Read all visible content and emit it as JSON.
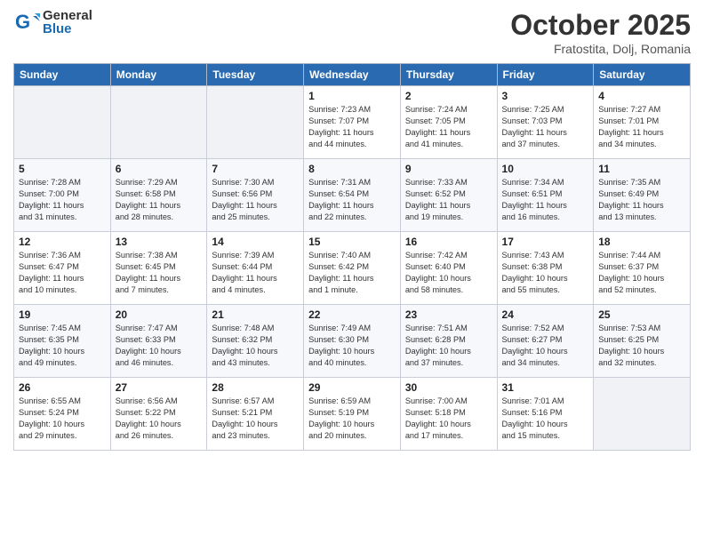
{
  "header": {
    "logo_general": "General",
    "logo_blue": "Blue",
    "month_title": "October 2025",
    "location": "Fratostita, Dolj, Romania"
  },
  "weekdays": [
    "Sunday",
    "Monday",
    "Tuesday",
    "Wednesday",
    "Thursday",
    "Friday",
    "Saturday"
  ],
  "weeks": [
    [
      {
        "day": "",
        "info": ""
      },
      {
        "day": "",
        "info": ""
      },
      {
        "day": "",
        "info": ""
      },
      {
        "day": "1",
        "info": "Sunrise: 7:23 AM\nSunset: 7:07 PM\nDaylight: 11 hours\nand 44 minutes."
      },
      {
        "day": "2",
        "info": "Sunrise: 7:24 AM\nSunset: 7:05 PM\nDaylight: 11 hours\nand 41 minutes."
      },
      {
        "day": "3",
        "info": "Sunrise: 7:25 AM\nSunset: 7:03 PM\nDaylight: 11 hours\nand 37 minutes."
      },
      {
        "day": "4",
        "info": "Sunrise: 7:27 AM\nSunset: 7:01 PM\nDaylight: 11 hours\nand 34 minutes."
      }
    ],
    [
      {
        "day": "5",
        "info": "Sunrise: 7:28 AM\nSunset: 7:00 PM\nDaylight: 11 hours\nand 31 minutes."
      },
      {
        "day": "6",
        "info": "Sunrise: 7:29 AM\nSunset: 6:58 PM\nDaylight: 11 hours\nand 28 minutes."
      },
      {
        "day": "7",
        "info": "Sunrise: 7:30 AM\nSunset: 6:56 PM\nDaylight: 11 hours\nand 25 minutes."
      },
      {
        "day": "8",
        "info": "Sunrise: 7:31 AM\nSunset: 6:54 PM\nDaylight: 11 hours\nand 22 minutes."
      },
      {
        "day": "9",
        "info": "Sunrise: 7:33 AM\nSunset: 6:52 PM\nDaylight: 11 hours\nand 19 minutes."
      },
      {
        "day": "10",
        "info": "Sunrise: 7:34 AM\nSunset: 6:51 PM\nDaylight: 11 hours\nand 16 minutes."
      },
      {
        "day": "11",
        "info": "Sunrise: 7:35 AM\nSunset: 6:49 PM\nDaylight: 11 hours\nand 13 minutes."
      }
    ],
    [
      {
        "day": "12",
        "info": "Sunrise: 7:36 AM\nSunset: 6:47 PM\nDaylight: 11 hours\nand 10 minutes."
      },
      {
        "day": "13",
        "info": "Sunrise: 7:38 AM\nSunset: 6:45 PM\nDaylight: 11 hours\nand 7 minutes."
      },
      {
        "day": "14",
        "info": "Sunrise: 7:39 AM\nSunset: 6:44 PM\nDaylight: 11 hours\nand 4 minutes."
      },
      {
        "day": "15",
        "info": "Sunrise: 7:40 AM\nSunset: 6:42 PM\nDaylight: 11 hours\nand 1 minute."
      },
      {
        "day": "16",
        "info": "Sunrise: 7:42 AM\nSunset: 6:40 PM\nDaylight: 10 hours\nand 58 minutes."
      },
      {
        "day": "17",
        "info": "Sunrise: 7:43 AM\nSunset: 6:38 PM\nDaylight: 10 hours\nand 55 minutes."
      },
      {
        "day": "18",
        "info": "Sunrise: 7:44 AM\nSunset: 6:37 PM\nDaylight: 10 hours\nand 52 minutes."
      }
    ],
    [
      {
        "day": "19",
        "info": "Sunrise: 7:45 AM\nSunset: 6:35 PM\nDaylight: 10 hours\nand 49 minutes."
      },
      {
        "day": "20",
        "info": "Sunrise: 7:47 AM\nSunset: 6:33 PM\nDaylight: 10 hours\nand 46 minutes."
      },
      {
        "day": "21",
        "info": "Sunrise: 7:48 AM\nSunset: 6:32 PM\nDaylight: 10 hours\nand 43 minutes."
      },
      {
        "day": "22",
        "info": "Sunrise: 7:49 AM\nSunset: 6:30 PM\nDaylight: 10 hours\nand 40 minutes."
      },
      {
        "day": "23",
        "info": "Sunrise: 7:51 AM\nSunset: 6:28 PM\nDaylight: 10 hours\nand 37 minutes."
      },
      {
        "day": "24",
        "info": "Sunrise: 7:52 AM\nSunset: 6:27 PM\nDaylight: 10 hours\nand 34 minutes."
      },
      {
        "day": "25",
        "info": "Sunrise: 7:53 AM\nSunset: 6:25 PM\nDaylight: 10 hours\nand 32 minutes."
      }
    ],
    [
      {
        "day": "26",
        "info": "Sunrise: 6:55 AM\nSunset: 5:24 PM\nDaylight: 10 hours\nand 29 minutes."
      },
      {
        "day": "27",
        "info": "Sunrise: 6:56 AM\nSunset: 5:22 PM\nDaylight: 10 hours\nand 26 minutes."
      },
      {
        "day": "28",
        "info": "Sunrise: 6:57 AM\nSunset: 5:21 PM\nDaylight: 10 hours\nand 23 minutes."
      },
      {
        "day": "29",
        "info": "Sunrise: 6:59 AM\nSunset: 5:19 PM\nDaylight: 10 hours\nand 20 minutes."
      },
      {
        "day": "30",
        "info": "Sunrise: 7:00 AM\nSunset: 5:18 PM\nDaylight: 10 hours\nand 17 minutes."
      },
      {
        "day": "31",
        "info": "Sunrise: 7:01 AM\nSunset: 5:16 PM\nDaylight: 10 hours\nand 15 minutes."
      },
      {
        "day": "",
        "info": ""
      }
    ]
  ]
}
